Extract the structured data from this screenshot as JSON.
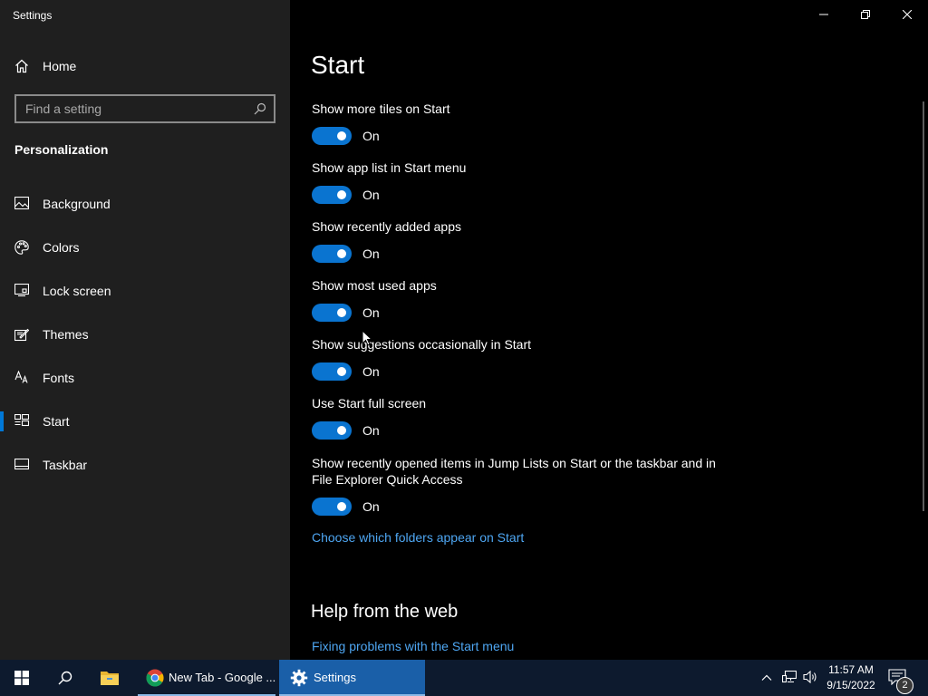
{
  "window": {
    "title": "Settings",
    "controls": [
      "minimize-icon",
      "restore-icon",
      "close-icon"
    ]
  },
  "sidebar": {
    "home_label": "Home",
    "search_placeholder": "Find a setting",
    "section_title": "Personalization",
    "items": [
      {
        "label": "Background",
        "icon": "background-icon"
      },
      {
        "label": "Colors",
        "icon": "palette-icon"
      },
      {
        "label": "Lock screen",
        "icon": "lock-screen-icon"
      },
      {
        "label": "Themes",
        "icon": "themes-icon"
      },
      {
        "label": "Fonts",
        "icon": "fonts-icon"
      },
      {
        "label": "Start",
        "icon": "start-layout-icon",
        "selected": true
      },
      {
        "label": "Taskbar",
        "icon": "taskbar-icon"
      }
    ]
  },
  "main": {
    "title": "Start",
    "settings": [
      {
        "label": "Show more tiles on Start",
        "state": "On"
      },
      {
        "label": "Show app list in Start menu",
        "state": "On"
      },
      {
        "label": "Show recently added apps",
        "state": "On"
      },
      {
        "label": "Show most used apps",
        "state": "On"
      },
      {
        "label": "Show suggestions occasionally in Start",
        "state": "On"
      },
      {
        "label": "Use Start full screen",
        "state": "On"
      },
      {
        "label": "Show recently opened items in Jump Lists on Start or the taskbar and in File Explorer Quick Access",
        "state": "On"
      }
    ],
    "folders_link": "Choose which folders appear on Start",
    "help_title": "Help from the web",
    "help_link": "Fixing problems with the Start menu"
  },
  "taskbar": {
    "apps": [
      {
        "label": "New Tab - Google ...",
        "icon": "chrome-icon"
      },
      {
        "label": "Settings",
        "icon": "gear-icon"
      }
    ],
    "clock_time": "11:57 AM",
    "clock_date": "9/15/2022",
    "notification_count": "2"
  },
  "colors": {
    "accent": "#0078d7",
    "toggle_on": "#0a74d0",
    "link": "#4ea6f2",
    "sidebar_bg": "#1f1f1f",
    "content_bg": "#000000",
    "taskbar_bg": "#0d1a2e"
  }
}
